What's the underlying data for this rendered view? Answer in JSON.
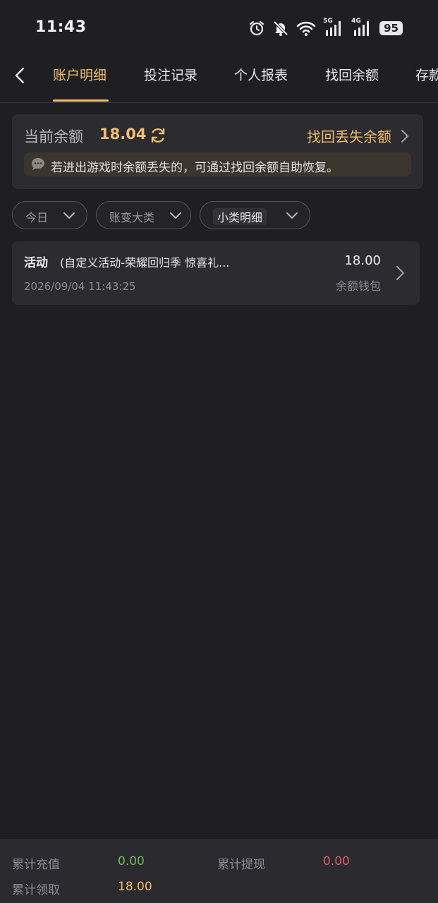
{
  "status_bar": {
    "time": "11:43",
    "network_1": "5G",
    "network_2": "4G",
    "battery": "95",
    "icons": [
      "alarm-icon",
      "bell-muted-icon",
      "wifi-icon",
      "signal-icon",
      "signal-icon"
    ]
  },
  "tabs": [
    {
      "label": "账户明细",
      "active": true
    },
    {
      "label": "投注记录",
      "active": false
    },
    {
      "label": "个人报表",
      "active": false
    },
    {
      "label": "找回余额",
      "active": false
    },
    {
      "label": "存款",
      "active": false
    }
  ],
  "balance": {
    "label": "当前余额",
    "value": "18.04",
    "recover_link": "找回丢失余额",
    "notice": "若进出游戏时余额丢失的，可通过找回余额自助恢复。"
  },
  "filters": [
    {
      "label": "今日",
      "highlighted": false
    },
    {
      "label": "账变大类",
      "highlighted": false
    },
    {
      "label": "小类明细",
      "highlighted": true
    }
  ],
  "records": [
    {
      "category": "活动",
      "description": "(自定义活动-荣耀回归季 惊喜礼...",
      "time": "2026/09/04 11:43:25",
      "amount": "18.00",
      "wallet": "余额钱包"
    }
  ],
  "footer": {
    "recharge_label": "累计充值",
    "recharge_value": "0.00",
    "withdraw_label": "累计提现",
    "withdraw_value": "0.00",
    "claimed_label": "累计领取",
    "claimed_value": "18.00"
  },
  "colors": {
    "accent": "#f0bd6c",
    "background": "#1f1f23",
    "card": "#2b2b30",
    "positive": "#6fbf5a",
    "negative": "#e25a6a"
  }
}
